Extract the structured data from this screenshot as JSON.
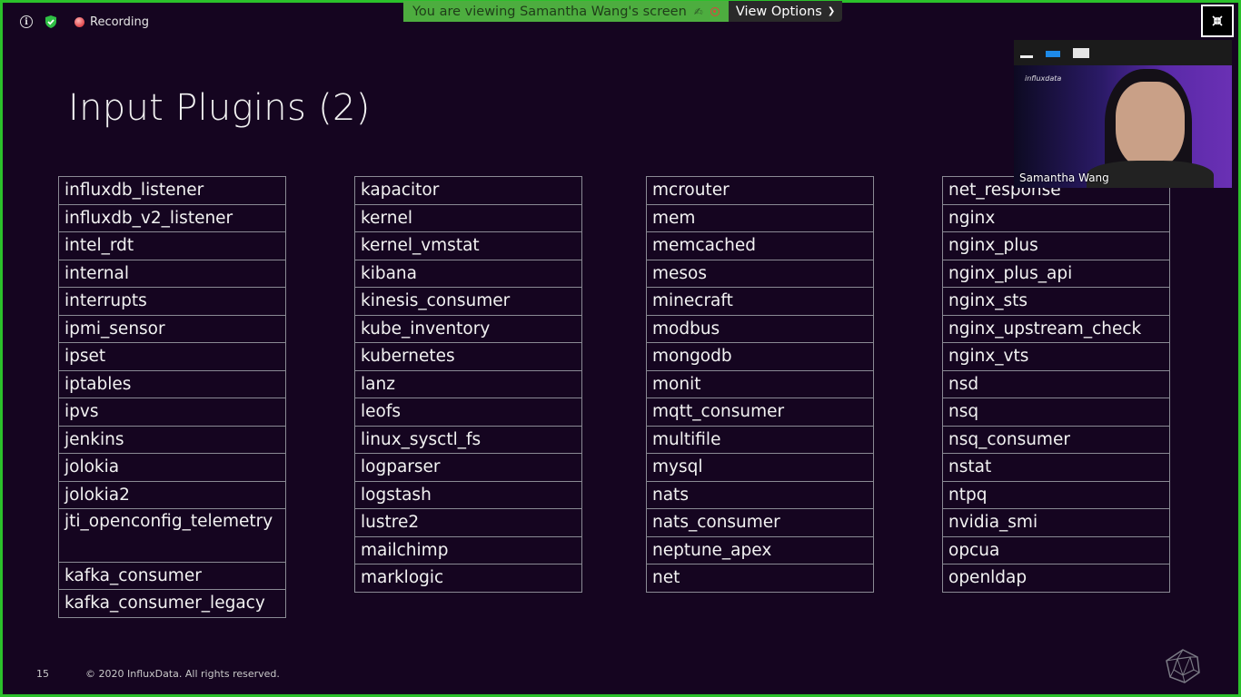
{
  "status": {
    "recording_label": "Recording"
  },
  "banner": {
    "message": "You are viewing Samantha Wang's screen",
    "view_options": "View Options"
  },
  "slide": {
    "title": "Input Plugins (2)",
    "columns": [
      [
        "influxdb_listener",
        "influxdb_v2_listener",
        "intel_rdt",
        "internal",
        "interrupts",
        "ipmi_sensor",
        "ipset",
        "iptables",
        "ipvs",
        "jenkins",
        "jolokia",
        "jolokia2",
        "jti_openconfig_telemetry",
        "kafka_consumer",
        "kafka_consumer_legacy"
      ],
      [
        "kapacitor",
        "kernel",
        "kernel_vmstat",
        "kibana",
        "kinesis_consumer",
        "kube_inventory",
        "kubernetes",
        "lanz",
        "leofs",
        "linux_sysctl_fs",
        "logparser",
        "logstash",
        "lustre2",
        "mailchimp",
        "marklogic"
      ],
      [
        "mcrouter",
        "mem",
        "memcached",
        "mesos",
        "minecraft",
        "modbus",
        "mongodb",
        "monit",
        "mqtt_consumer",
        "multifile",
        "mysql",
        "nats",
        "nats_consumer",
        "neptune_apex",
        "net"
      ],
      [
        "net_response",
        "nginx",
        "nginx_plus",
        "nginx_plus_api",
        "nginx_sts",
        "nginx_upstream_check",
        "nginx_vts",
        "nsd",
        "nsq",
        "nsq_consumer",
        "nstat",
        "ntpq",
        "nvidia_smi",
        "opcua",
        "openldap"
      ]
    ],
    "page_number": "15",
    "copyright": "© 2020 InfluxData. All rights reserved."
  },
  "video": {
    "participant_name": "Samantha Wang",
    "logo_text": "influxdata"
  },
  "icons": {
    "info": "info-icon",
    "security": "shield-icon",
    "exit_fullscreen": "exit-fullscreen-icon"
  },
  "colors": {
    "frame_border": "#2bc12b",
    "banner_bg": "#4dad3f",
    "slide_bg": "#150520"
  }
}
